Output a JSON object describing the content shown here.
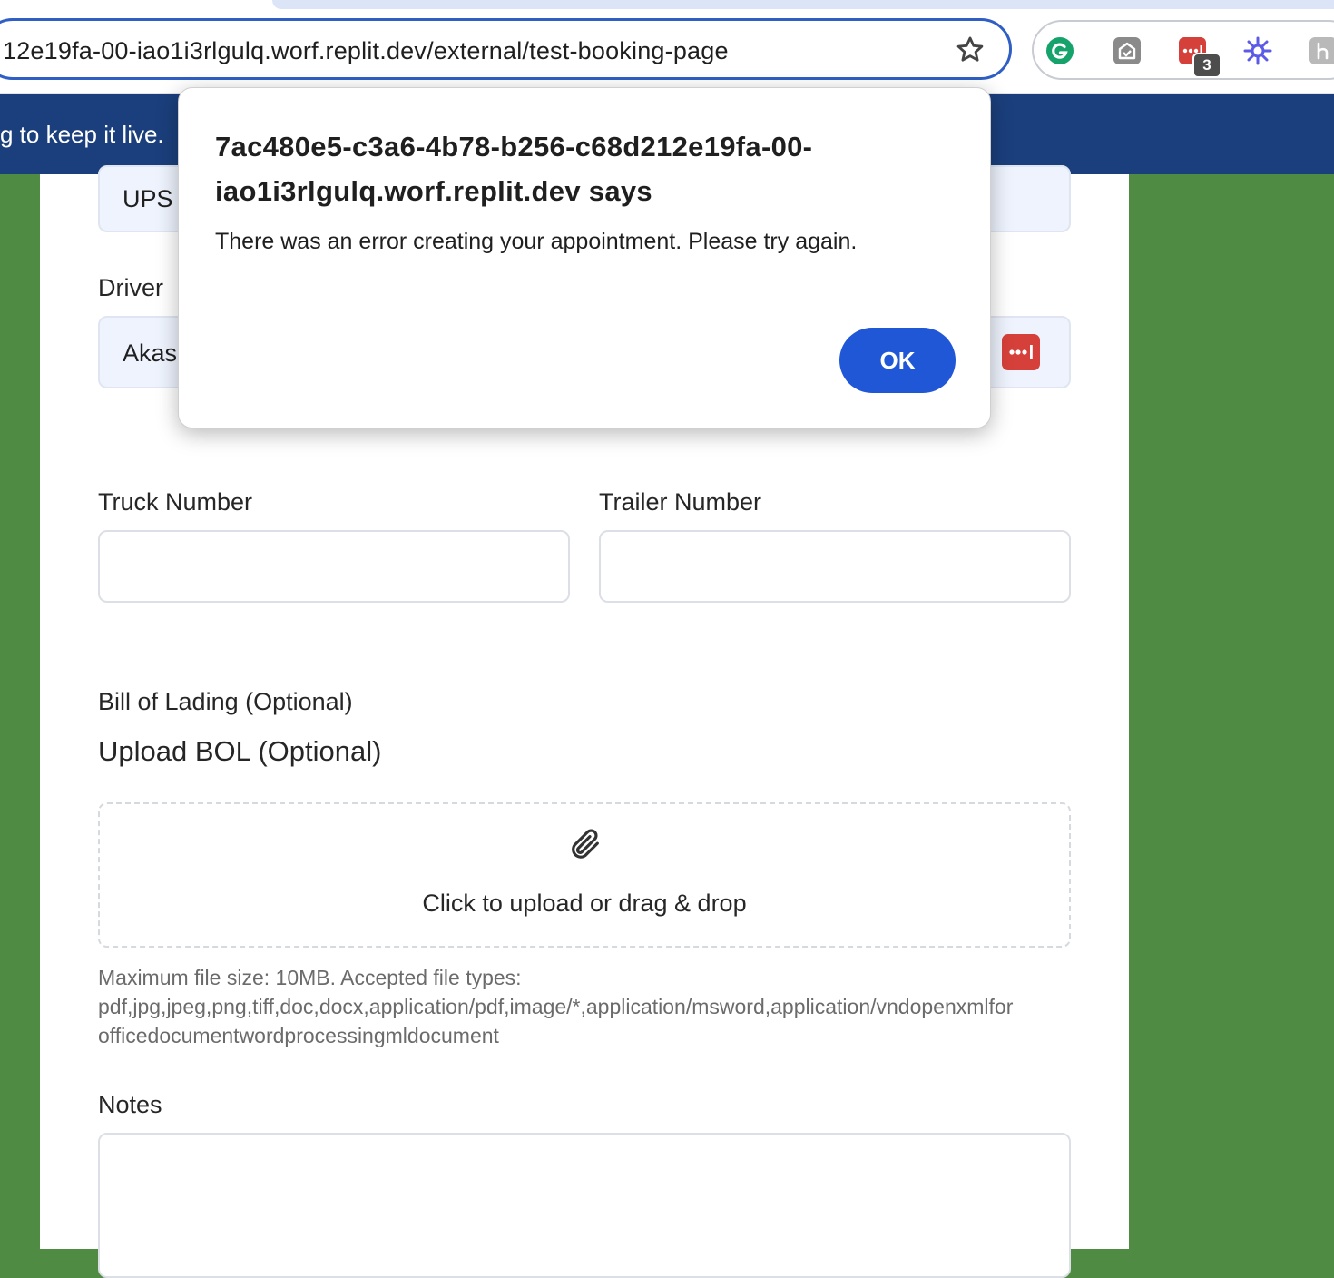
{
  "browser": {
    "url": "12e19fa-00-iao1i3rlgulq.worf.replit.dev/external/test-booking-page",
    "extension_badge_count": "3"
  },
  "banner": {
    "text": "g to keep it live."
  },
  "form": {
    "carrier_value": "UPS",
    "driver_label": "Driver",
    "driver_value": "Akas",
    "truck_label": "Truck Number",
    "trailer_label": "Trailer Number",
    "bol_label": "Bill of Lading (Optional)",
    "upload_heading": "Upload BOL (Optional)",
    "dropzone_text": "Click to upload or drag & drop",
    "file_help_line1": "Maximum file size: 10MB. Accepted file types:",
    "file_help_line2": "pdf,jpg,jpeg,png,tiff,doc,docx,application/pdf,image/*,application/msword,application/vndopenxmlfor",
    "file_help_line3": "officedocumentwordprocessingmldocument",
    "notes_label": "Notes"
  },
  "dialog": {
    "title_line1": "7ac480e5-c3a6-4b78-b256-c68d212e19fa-00-",
    "title_line2": "iao1i3rlgulq.worf.replit.dev says",
    "message": "There was an error creating your appointment. Please try again.",
    "ok_label": "OK"
  },
  "colors": {
    "page_background": "#4f8b43",
    "banner": "#1b3f7c",
    "ok_button": "#1f57d6",
    "address_focus": "#2f5fc4"
  }
}
